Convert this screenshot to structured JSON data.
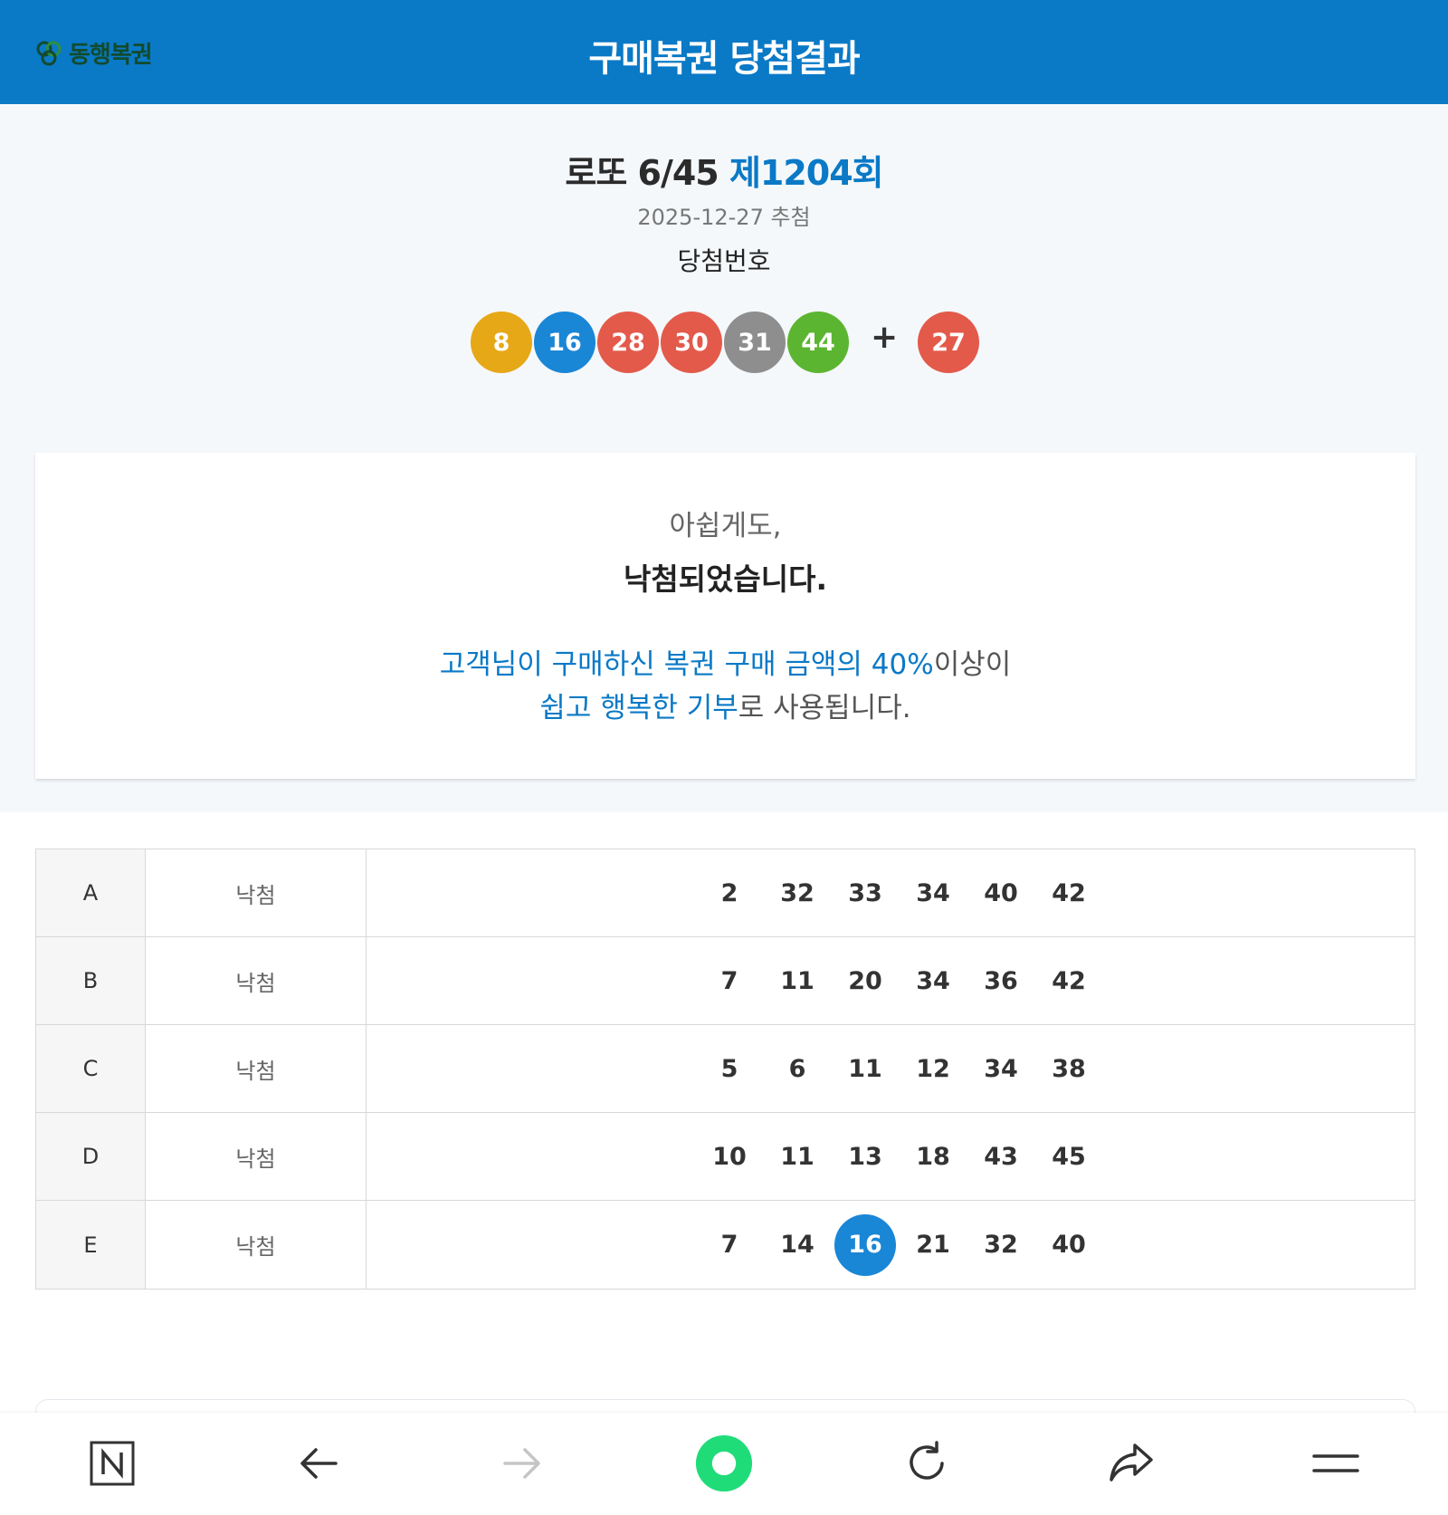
{
  "header": {
    "logo_text": "동행복권",
    "title": "구매복권 당첨결과"
  },
  "draw": {
    "game": "로또 6/45",
    "round": "제1204회",
    "date": "2025-12-27 추첨",
    "winning_label": "당첨번호",
    "numbers": [
      "8",
      "16",
      "28",
      "30",
      "31",
      "44"
    ],
    "number_colors": [
      "#e6a817",
      "#1a86d6",
      "#e35a4b",
      "#e35a4b",
      "#8e8e8e",
      "#5cb531"
    ],
    "plus": "+",
    "bonus": "27",
    "bonus_color": "#e35a4b"
  },
  "result": {
    "line1": "아쉽게도,",
    "line2": "낙첨되었습니다.",
    "donate_blue1": "고객님이 구매하신 복권 구매 금액의 40%",
    "donate_rest1": "이상이",
    "donate_blue2": "쉽고 행복한 기부",
    "donate_rest2": "로 사용됩니다."
  },
  "tickets": [
    {
      "game": "A",
      "status": "낙첨",
      "numbers": [
        "2",
        "32",
        "33",
        "34",
        "40",
        "42"
      ],
      "hits": []
    },
    {
      "game": "B",
      "status": "낙첨",
      "numbers": [
        "7",
        "11",
        "20",
        "34",
        "36",
        "42"
      ],
      "hits": []
    },
    {
      "game": "C",
      "status": "낙첨",
      "numbers": [
        "5",
        "6",
        "11",
        "12",
        "34",
        "38"
      ],
      "hits": []
    },
    {
      "game": "D",
      "status": "낙첨",
      "numbers": [
        "10",
        "11",
        "13",
        "18",
        "43",
        "45"
      ],
      "hits": []
    },
    {
      "game": "E",
      "status": "낙첨",
      "numbers": [
        "7",
        "14",
        "16",
        "21",
        "32",
        "40"
      ],
      "hits": [
        2
      ]
    }
  ],
  "bottom_nav": {
    "icons": [
      "naver-n-icon",
      "back-arrow-icon",
      "forward-arrow-icon",
      "green-dot-icon",
      "refresh-icon",
      "share-icon",
      "menu-icon"
    ],
    "accent": "#1fdc79"
  }
}
